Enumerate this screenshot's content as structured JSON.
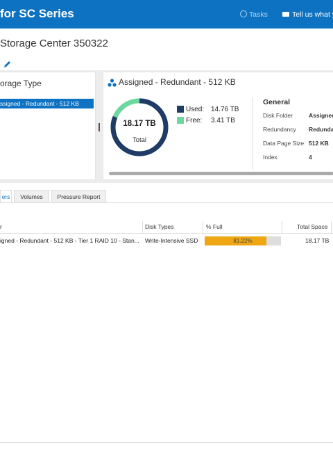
{
  "header": {
    "app_title": "for SC Series",
    "tasks_label": "Tasks",
    "feedback_label": "Tell us what yo"
  },
  "page": {
    "title": "Storage Center 350322"
  },
  "storage_type_panel": {
    "title": "orage Type",
    "items": [
      {
        "label": "ssigned - Redundant - 512 KB",
        "selected": true
      }
    ]
  },
  "detail_panel": {
    "title": "Assigned - Redundant - 512 KB",
    "usage": {
      "total_value": "18.17 TB",
      "total_label": "Total",
      "used_label": "Used:",
      "used_value": "14.76 TB",
      "free_label": "Free:",
      "free_value": "3.41 TB",
      "used_fraction": 0.8122
    },
    "colors": {
      "used": "#1f3b66",
      "free": "#6dd7a0"
    },
    "general": {
      "title": "General",
      "rows": [
        {
          "label": "Disk Folder",
          "value": "Assigned"
        },
        {
          "label": "Redundancy",
          "value": "Redunda"
        },
        {
          "label": "Data Page Size",
          "value": "512 KB"
        },
        {
          "label": "Index",
          "value": "4"
        }
      ]
    }
  },
  "tabs": [
    {
      "label": "ers",
      "active": true
    },
    {
      "label": "Volumes",
      "active": false
    },
    {
      "label": "Pressure Report",
      "active": false
    }
  ],
  "table": {
    "columns": [
      "r",
      "Disk Types",
      "% Full",
      "Total Space"
    ],
    "rows": [
      {
        "name": "igned - Redundant - 512 KB - Tier 1 RAID 10 - Stan...",
        "disk_types": "Write-Intensive SSD",
        "percent_full": 81.22,
        "percent_label": "81.22%",
        "total_space": "18.17 TB"
      }
    ],
    "bar_color": "#eea712"
  }
}
